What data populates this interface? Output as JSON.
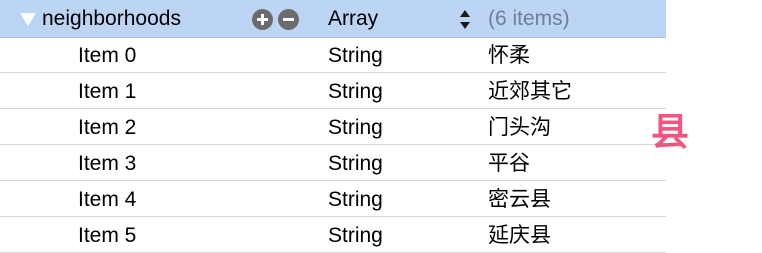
{
  "root": {
    "key": "neighborhoods",
    "type": "Array",
    "summary": "(6 items)"
  },
  "items": [
    {
      "key": "Item 0",
      "type": "String",
      "value": "怀柔"
    },
    {
      "key": "Item 1",
      "type": "String",
      "value": "近郊其它"
    },
    {
      "key": "Item 2",
      "type": "String",
      "value": "门头沟"
    },
    {
      "key": "Item 3",
      "type": "String",
      "value": "平谷"
    },
    {
      "key": "Item 4",
      "type": "String",
      "value": "密云县"
    },
    {
      "key": "Item 5",
      "type": "String",
      "value": "延庆县"
    }
  ],
  "overlay_character": "县",
  "colors": {
    "header_selection": "#bcd5f5",
    "overlay_accent": "#f2557f"
  }
}
